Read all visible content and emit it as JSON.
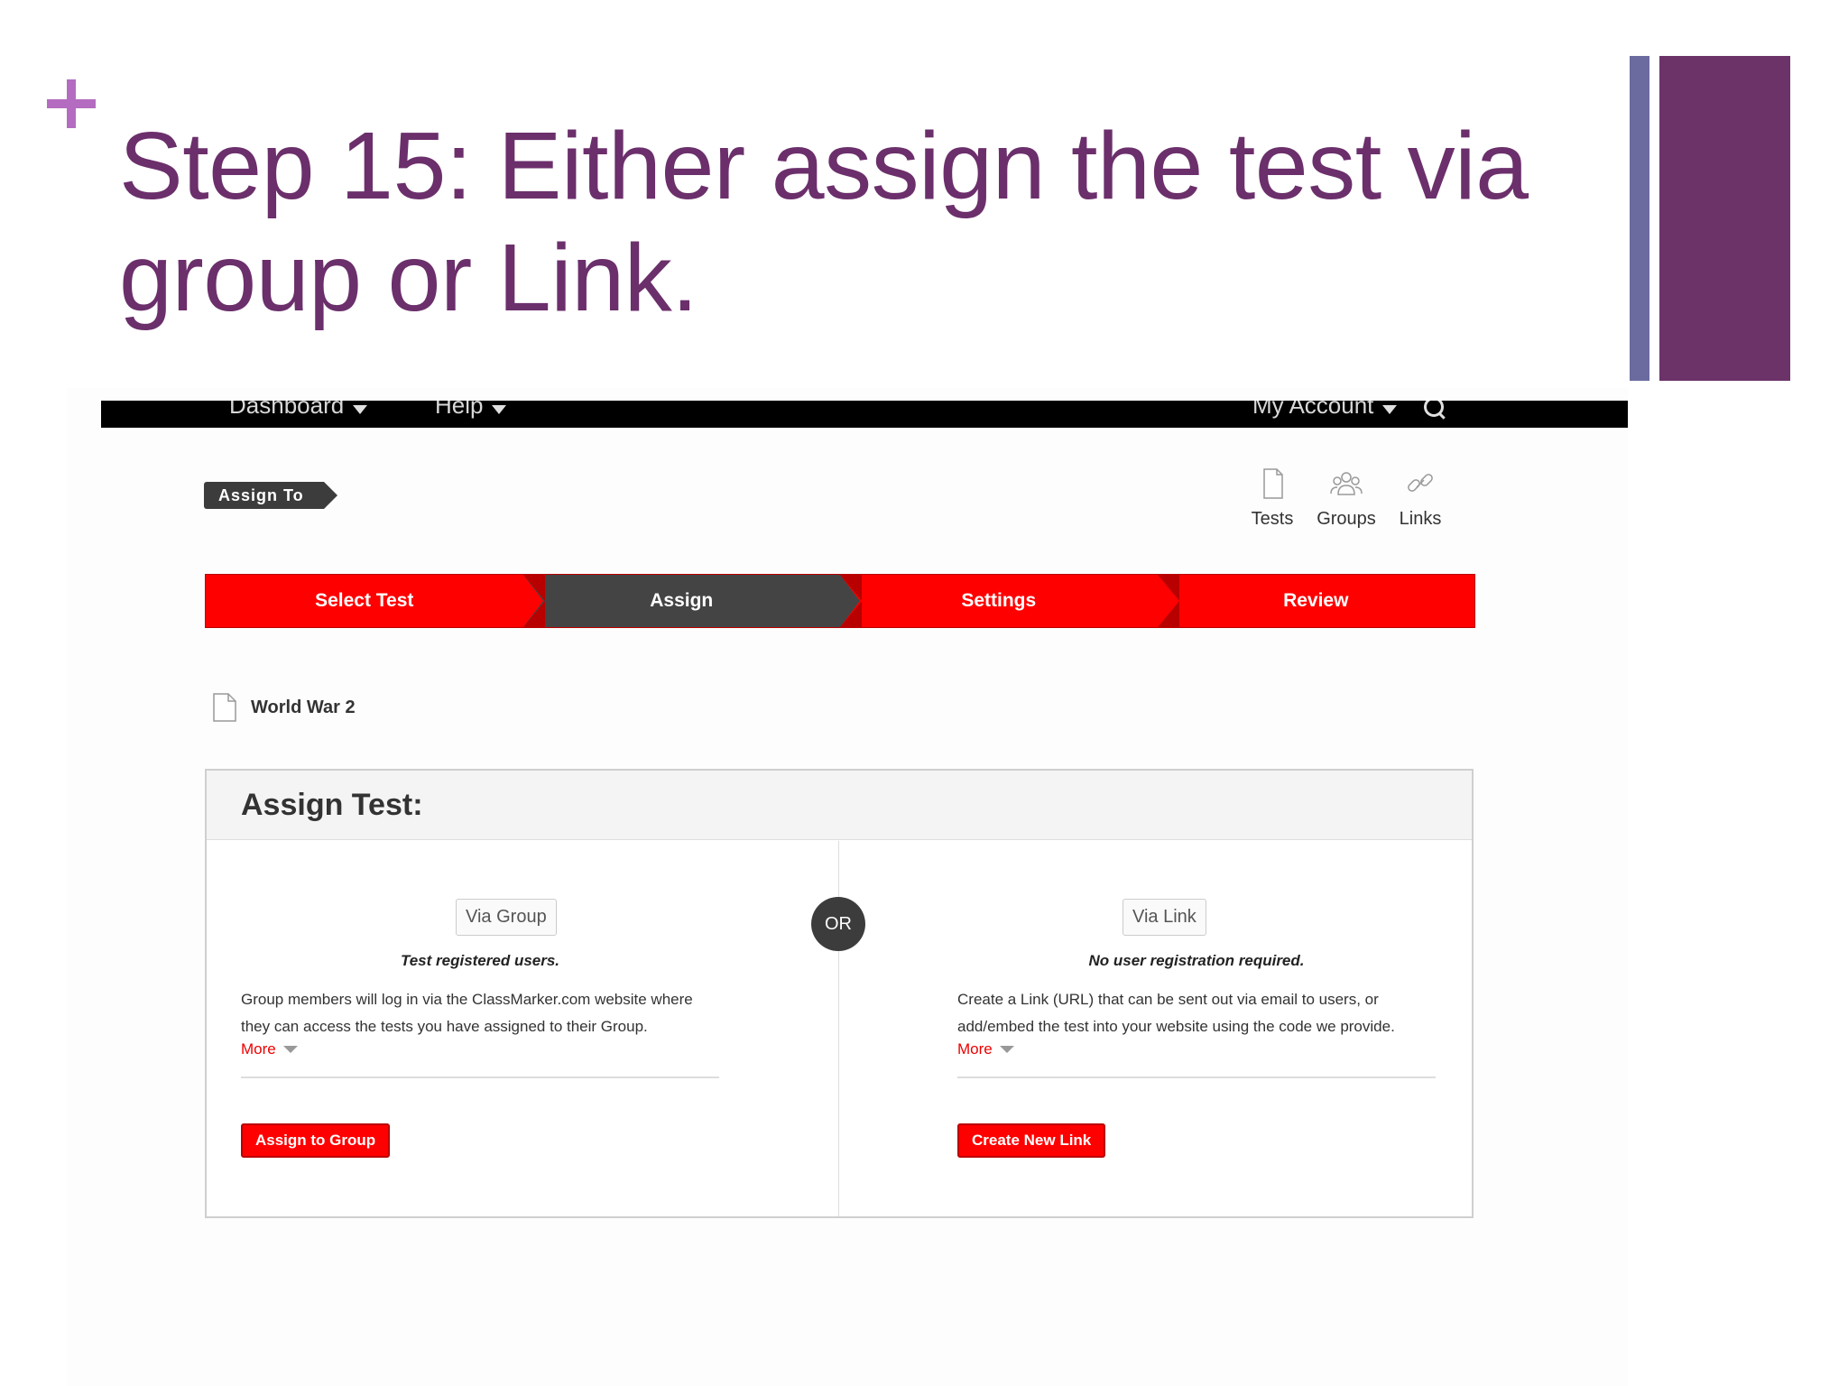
{
  "slide": {
    "title": "Step 15: Either assign the test via group or Link."
  },
  "topnav": {
    "items": [
      {
        "label": "Dashboard"
      },
      {
        "label": "Help"
      },
      {
        "label": "My Account"
      }
    ]
  },
  "assign_to": {
    "label": "Assign To"
  },
  "quick_links": [
    {
      "label": "Tests",
      "icon": "document-icon"
    },
    {
      "label": "Groups",
      "icon": "groups-icon"
    },
    {
      "label": "Links",
      "icon": "link-icon"
    }
  ],
  "steps": [
    {
      "label": "Select Test",
      "state": "done"
    },
    {
      "label": "Assign",
      "state": "active"
    },
    {
      "label": "Settings",
      "state": "pending"
    },
    {
      "label": "Review",
      "state": "pending"
    }
  ],
  "test": {
    "name": "World War 2"
  },
  "panel": {
    "title": "Assign Test:",
    "or_label": "OR",
    "via_group": {
      "tag": "Via Group",
      "subtitle": "Test registered users.",
      "description": "Group members will log in via the ClassMarker.com website where they can access the tests you have assigned to their Group.",
      "more": "More",
      "button": "Assign to Group"
    },
    "via_link": {
      "tag": "Via Link",
      "subtitle": "No user registration required.",
      "description": "Create a Link (URL) that can be sent out via email to users, or add/embed the test into your website using the code we provide.",
      "more": "More",
      "button": "Create New Link"
    }
  },
  "colors": {
    "title_purple": "#6b2f6b",
    "accent_red": "#ff0000",
    "dark": "#444444"
  }
}
